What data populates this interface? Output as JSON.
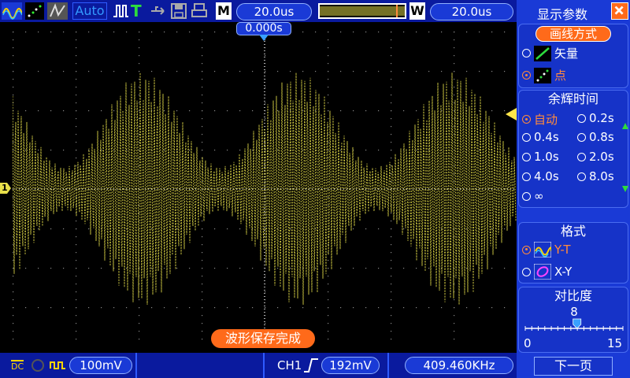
{
  "toolbar": {
    "auto_label": "Auto",
    "trig_label": "T",
    "m_label": "M",
    "timebase": "20.0us",
    "w_label": "W",
    "window_timebase": "20.0us",
    "trigger_offset": "0.000s",
    "channel1_marker": "1"
  },
  "status": {
    "message": "波形保存完成"
  },
  "bottom": {
    "coupling": "DC",
    "ch1_scale": "100mV",
    "trig_source": "CH1",
    "trig_level": "192mV",
    "frequency": "409.460KHz"
  },
  "side": {
    "title": "显示参数",
    "draw_section_title": "画线方式",
    "draw_options": [
      {
        "label": "矢量",
        "selected": false
      },
      {
        "label": "点",
        "selected": true
      }
    ],
    "persist_title": "余辉时间",
    "persist_options": [
      {
        "label": "自动",
        "selected": true
      },
      {
        "label": "0.2s",
        "selected": false
      },
      {
        "label": "0.4s",
        "selected": false
      },
      {
        "label": "0.8s",
        "selected": false
      },
      {
        "label": "1.0s",
        "selected": false
      },
      {
        "label": "2.0s",
        "selected": false
      },
      {
        "label": "4.0s",
        "selected": false
      },
      {
        "label": "8.0s",
        "selected": false
      },
      {
        "label": "∞",
        "selected": false
      }
    ],
    "format_title": "格式",
    "format_options": [
      {
        "label": "Y-T",
        "selected": true
      },
      {
        "label": "X-Y",
        "selected": false
      }
    ],
    "contrast_title": "对比度",
    "contrast_value": "8",
    "contrast_min": "0",
    "contrast_max": "15",
    "contrast_level": 0.53,
    "next_page": "下一页"
  },
  "colors": {
    "trace": "#e8e04a",
    "accent": "#ff8a3d",
    "panel": "#1a3ad6",
    "bar": "#0a1a9e"
  }
}
